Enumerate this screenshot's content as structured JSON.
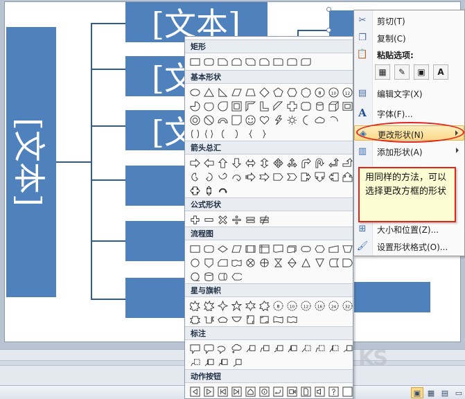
{
  "slide": {
    "big_box_text": "[文本]",
    "child_boxes": [
      {
        "text": "[文本]"
      },
      {
        "text": "[文"
      },
      {
        "text": "[文"
      },
      {
        "text": ""
      },
      {
        "text": ""
      },
      {
        "text": ""
      }
    ]
  },
  "shape_gallery": {
    "sections": [
      {
        "title": "矩形"
      },
      {
        "title": "基本形状"
      },
      {
        "title": "箭头总汇"
      },
      {
        "title": "公式形状"
      },
      {
        "title": "流程图"
      },
      {
        "title": "星与旗帜"
      },
      {
        "title": "标注"
      },
      {
        "title": "动作按钮"
      }
    ],
    "basic_shape_glyphs": {
      "number_8": "8",
      "number_10": "10",
      "number_12": "12"
    },
    "star_glyphs": [
      "8",
      "10",
      "12",
      "16",
      "24",
      "32"
    ]
  },
  "context_menu": {
    "cut": "剪切(T)",
    "copy": "复制(C)",
    "paste_options": "粘贴选项:",
    "paste_text_glyph": "A",
    "edit_text": "编辑文字(X)",
    "font": "字体(F)...",
    "font_glyph": "A",
    "change_shape": "更改形状(N)",
    "add_shape": "添加形状(A)",
    "size_position": "大小和位置(Z)...",
    "format_shape": "设置形状格式(O)..."
  },
  "callout": {
    "text": "用同样的方法，可以选择更改方框的形状"
  },
  "watermark": {
    "text": "KS"
  },
  "colors": {
    "shape_fill": "#4f81bd",
    "connector": "#2f5d93",
    "highlight": "#fbd98a",
    "annotation_red": "#e2231a",
    "callout_fill": "#fdfdd3"
  }
}
